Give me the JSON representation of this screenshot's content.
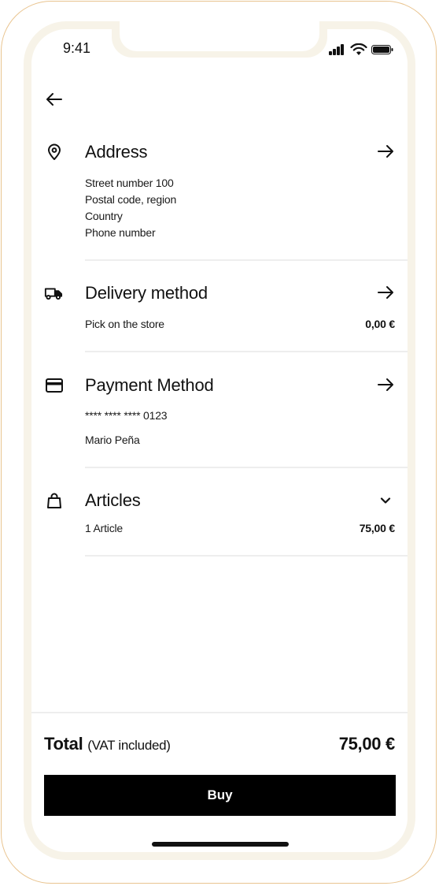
{
  "status_bar": {
    "time": "9:41"
  },
  "address": {
    "title": "Address",
    "lines": [
      "Street number 100",
      "Postal code, region",
      "Country",
      "Phone number"
    ]
  },
  "delivery": {
    "title": "Delivery method",
    "option": "Pick on the store",
    "price": "0,00 €"
  },
  "payment": {
    "title": "Payment Method",
    "card": "**** **** **** 0123",
    "holder": "Mario Peña"
  },
  "articles": {
    "title": "Articles",
    "count": "1 Article",
    "price": "75,00 €"
  },
  "footer": {
    "total_label": "Total",
    "total_note": "(VAT included)",
    "total_value": "75,00 €",
    "buy_label": "Buy"
  },
  "icons": {
    "back": "arrow-left-icon",
    "address": "location-pin-icon",
    "delivery": "truck-icon",
    "payment": "credit-card-icon",
    "articles": "shopping-bag-icon",
    "navigate": "arrow-right-icon",
    "expand": "chevron-down-icon"
  },
  "colors": {
    "frame": "#e9c48f",
    "bezel": "#f7f3e8",
    "button": "#000000",
    "text": "#111111"
  }
}
